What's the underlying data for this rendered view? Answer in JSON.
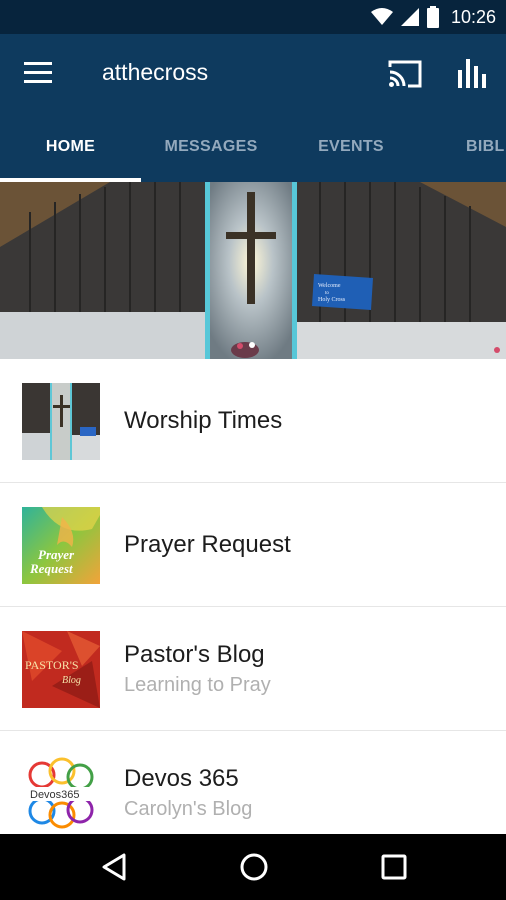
{
  "status_bar": {
    "time": "10:26",
    "icons": [
      "wifi-icon",
      "signal-icon",
      "battery-icon"
    ]
  },
  "app_bar": {
    "title": "atthecross",
    "icons": [
      "menu-icon",
      "cast-icon",
      "bar-chart-icon"
    ]
  },
  "tabs": [
    {
      "label": "HOME",
      "active": true
    },
    {
      "label": "MESSAGES",
      "active": false
    },
    {
      "label": "EVENTS",
      "active": false
    },
    {
      "label": "BIBL",
      "active": false
    }
  ],
  "hero": {
    "screen_text_line1": "Welcome",
    "screen_text_line2": "to",
    "screen_text_line3": "Holy Cross"
  },
  "list": [
    {
      "title": "Worship Times",
      "subtitle": "",
      "thumb": "worship-thumbnail"
    },
    {
      "title": "Prayer Request",
      "subtitle": "",
      "thumb": "prayer-request-thumbnail",
      "thumb_text": [
        "Prayer",
        "Request"
      ]
    },
    {
      "title": "Pastor's Blog",
      "subtitle": "Learning to Pray",
      "thumb": "pastors-blog-thumbnail",
      "thumb_text": [
        "PASTOR'S",
        "Blog"
      ]
    },
    {
      "title": "Devos 365",
      "subtitle": "Carolyn's Blog",
      "thumb": "devos365-thumbnail",
      "thumb_text": [
        "Devos365"
      ]
    }
  ],
  "colors": {
    "status_bar": "#07243d",
    "app_bar": "#0e3a5e",
    "tab_inactive": "#93a9bd",
    "tab_active": "#ffffff"
  },
  "nav_bar": {
    "icons": [
      "back-icon",
      "home-icon",
      "recents-icon"
    ]
  }
}
